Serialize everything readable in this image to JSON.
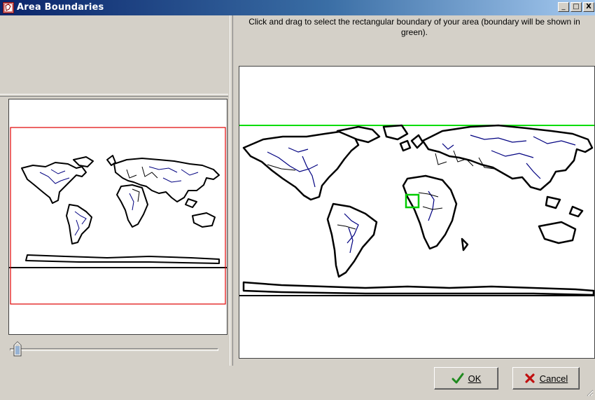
{
  "window": {
    "title": "Area Boundaries"
  },
  "titlebar_buttons": {
    "minimize": "_",
    "maximize": "□",
    "close": "X"
  },
  "instructions": "Click and drag to select the rectangular boundary of your area (boundary will be shown in green).",
  "buttons": {
    "ok": "OK",
    "cancel": "Cancel"
  },
  "colors": {
    "selection_red": "#e00000",
    "selection_green": "#00cc00",
    "rivers_blue": "#000080",
    "title_dark": "#0a246a"
  },
  "icons": {
    "ok": "check-icon",
    "cancel": "x-icon",
    "app": "app-map-icon"
  }
}
